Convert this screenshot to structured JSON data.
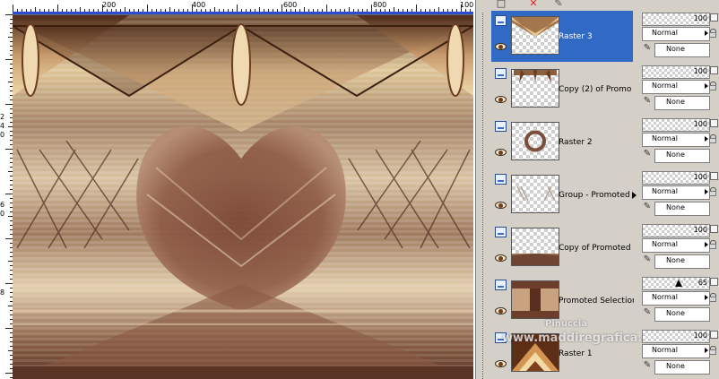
{
  "rulers": {
    "horizontal_labels": [
      "200",
      "400",
      "600",
      "800",
      "100"
    ],
    "vertical_labels": [
      "2",
      "4",
      "0",
      "6",
      "0",
      "8"
    ]
  },
  "toolbar": {
    "icons": [
      "new-layer-icon",
      "delete-icon",
      "edit-icon"
    ]
  },
  "layers": [
    {
      "name": "Raster 3",
      "opacity": "100",
      "blend": "Normal",
      "mask": "None",
      "selected": true,
      "thumb": "raster3"
    },
    {
      "name": "Copy (2) of Promo",
      "opacity": "100",
      "blend": "Normal",
      "mask": "None",
      "selected": false,
      "thumb": "copy2"
    },
    {
      "name": "Raster 2",
      "opacity": "100",
      "blend": "Normal",
      "mask": "None",
      "selected": false,
      "thumb": "ring"
    },
    {
      "name": "Group - Promoted :",
      "opacity": "100",
      "blend": "Normal",
      "mask": "None",
      "selected": false,
      "thumb": "group"
    },
    {
      "name": "Copy of Promoted",
      "opacity": "100",
      "blend": "Normal",
      "mask": "None",
      "selected": false,
      "thumb": "copy1"
    },
    {
      "name": "Promoted Selection",
      "opacity": "65",
      "blend": "Normal",
      "mask": "None",
      "selected": false,
      "thumb": "promoted"
    },
    {
      "name": "Raster 1",
      "opacity": "100",
      "blend": "Normal",
      "mask": "None",
      "selected": false,
      "thumb": "raster1"
    }
  ],
  "watermark": {
    "line1": "Pinuccia",
    "line2": "www.maddiregrafica.eu"
  },
  "colors": {
    "selection": "#316ac5",
    "palette_bg": "#d4d0c8",
    "ruler_accent": "#2a4dd6"
  }
}
